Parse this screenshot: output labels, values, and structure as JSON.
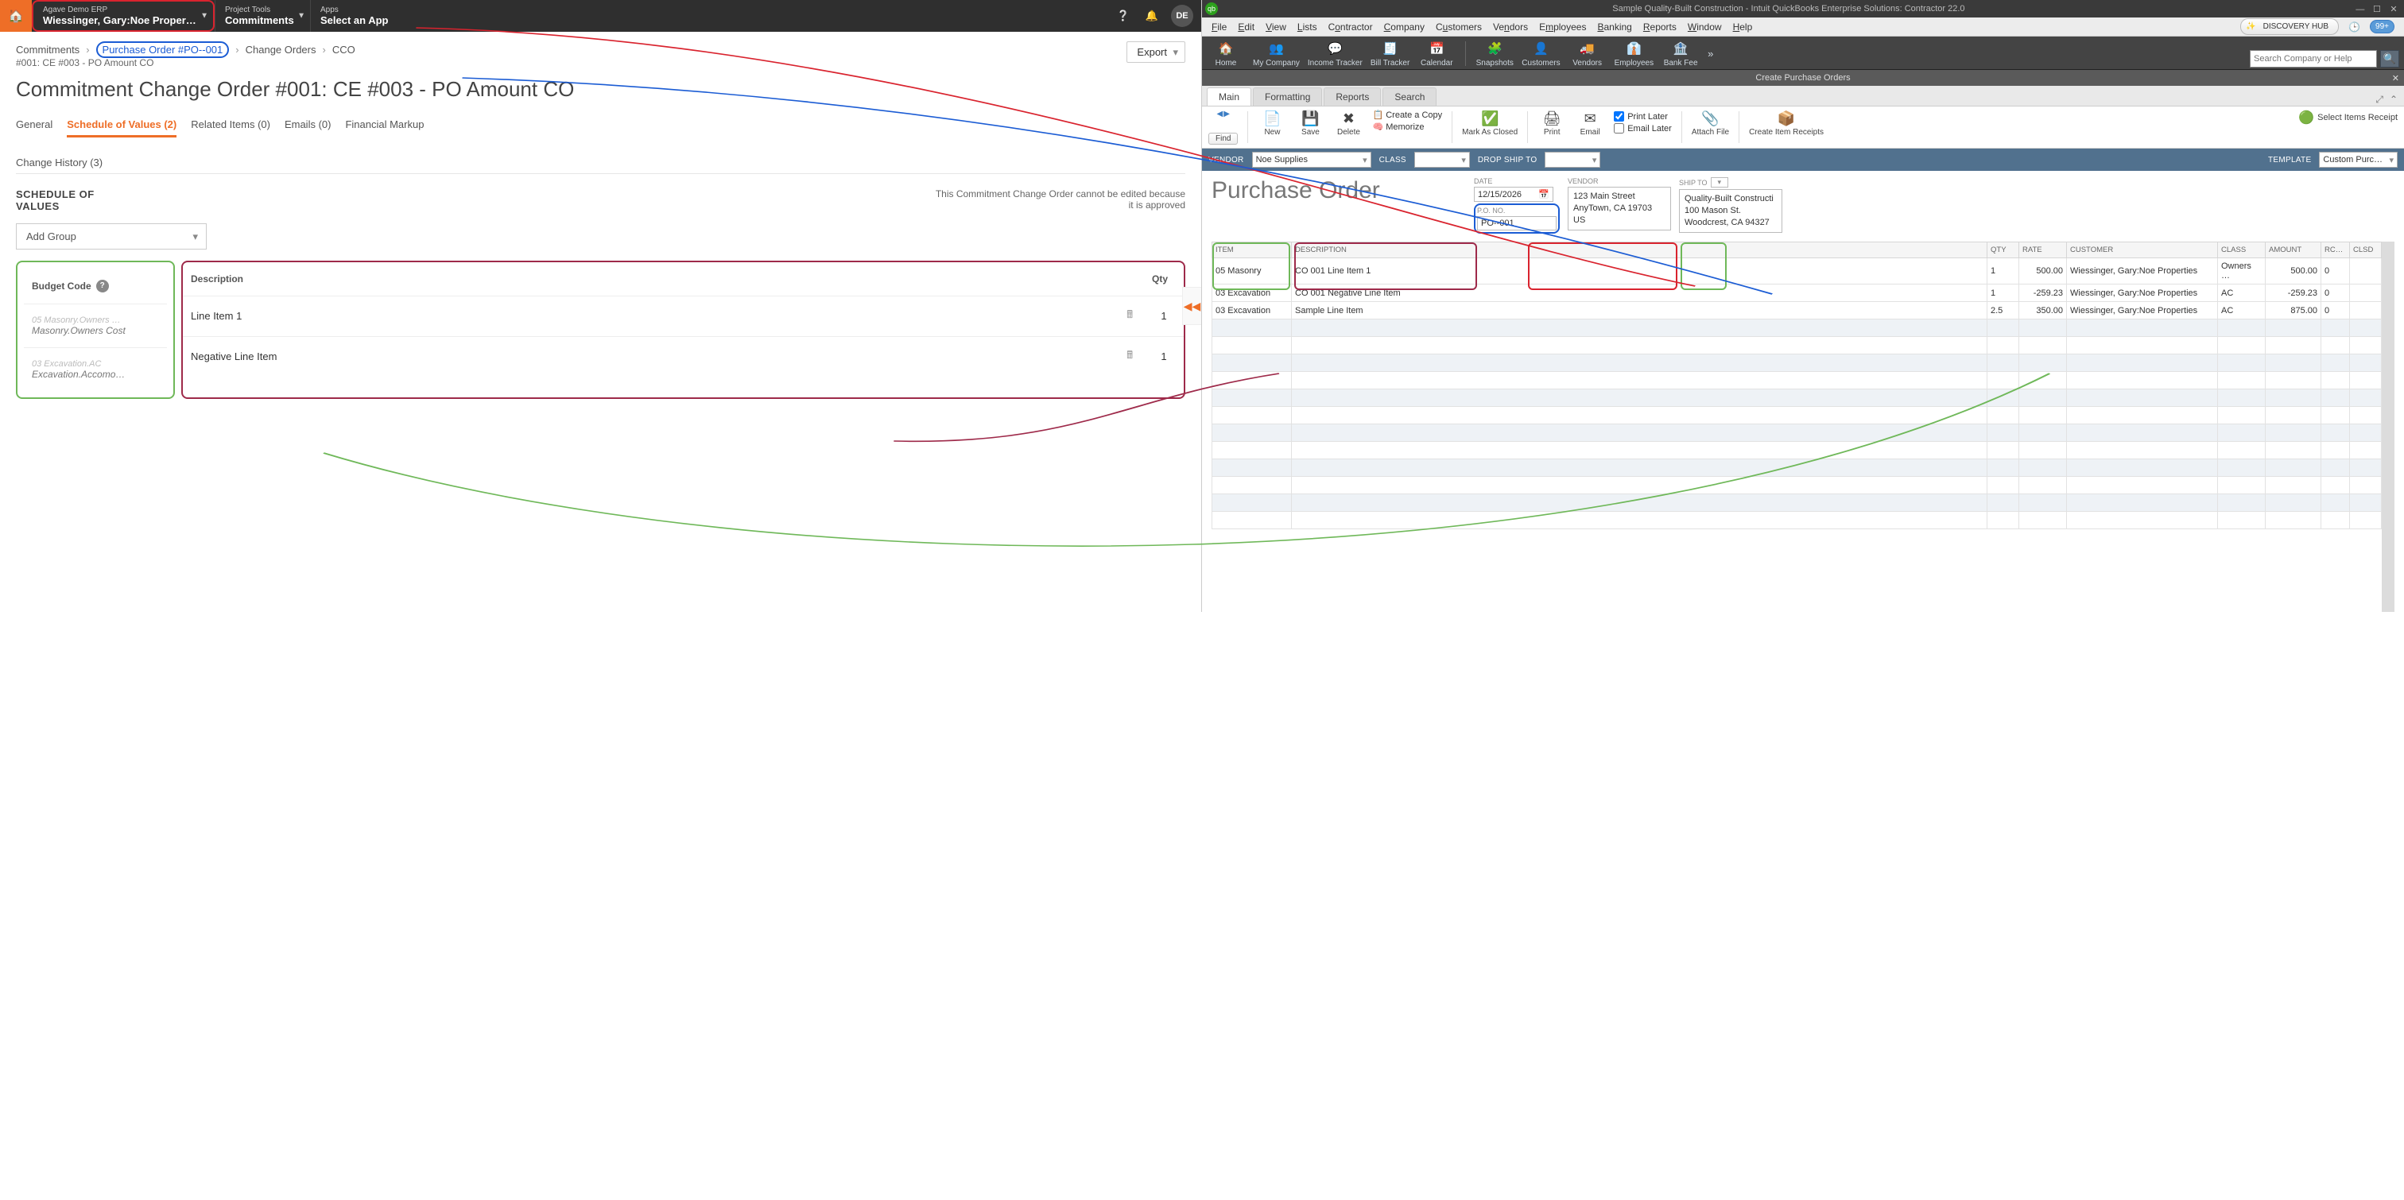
{
  "procore": {
    "erp_label": "Agave Demo ERP",
    "erp_value": "Wiessinger, Gary:Noe Proper…",
    "tools_label": "Project Tools",
    "tools_value": "Commitments",
    "apps_label": "Apps",
    "apps_value": "Select an App",
    "avatar": "DE",
    "breadcrumb": {
      "c1": "Commitments",
      "c2": "Purchase Order #PO--001",
      "c3": "Change Orders",
      "c4": "CCO",
      "sub": "#001: CE #003 - PO Amount CO"
    },
    "export": "Export",
    "page_title": "Commitment Change Order #001: CE #003 - PO Amount CO",
    "tabs": {
      "general": "General",
      "sov": "Schedule of Values (2)",
      "related": "Related Items (0)",
      "emails": "Emails (0)",
      "fin": "Financial Markup",
      "history": "Change History (3)"
    },
    "sov_heading": "SCHEDULE OF VALUES",
    "sov_note": "This Commitment Change Order cannot be edited because it is approved",
    "add_group": "Add Group",
    "cols": {
      "budget": "Budget Code",
      "desc": "Description",
      "qty": "Qty"
    },
    "rows": [
      {
        "code_faint": "05 Masonry.Owners …",
        "code_main": "Masonry.Owners Cost",
        "desc": "Line Item 1",
        "qty": "1"
      },
      {
        "code_faint": "03 Excavation.AC",
        "code_main": "Excavation.Accomo…",
        "desc": "Negative Line Item",
        "qty": "1"
      }
    ]
  },
  "qb": {
    "title": "Sample Quality-Built Construction  -  Intuit QuickBooks Enterprise Solutions: Contractor 22.0",
    "menu": [
      "File",
      "Edit",
      "View",
      "Lists",
      "Contractor",
      "Company",
      "Customers",
      "Vendors",
      "Employees",
      "Banking",
      "Reports",
      "Window",
      "Help"
    ],
    "discovery": "DISCOVERY HUB",
    "badge99": "99+",
    "ribbon": [
      {
        "icon": "🏠",
        "label": "Home"
      },
      {
        "icon": "👥",
        "label": "My Company"
      },
      {
        "icon": "💬",
        "label": "Income Tracker"
      },
      {
        "icon": "🧾",
        "label": "Bill Tracker"
      },
      {
        "icon": "📅",
        "label": "Calendar"
      },
      {
        "icon": "🧩",
        "label": "Snapshots"
      },
      {
        "icon": "👤",
        "label": "Customers"
      },
      {
        "icon": "🚚",
        "label": "Vendors"
      },
      {
        "icon": "👔",
        "label": "Employees"
      },
      {
        "icon": "🏦",
        "label": "Bank Fee"
      }
    ],
    "search_placeholder": "Search Company or Help",
    "doc_title_bar": "Create Purchase Orders",
    "subtabs": {
      "main": "Main",
      "formatting": "Formatting",
      "reports": "Reports",
      "search": "Search"
    },
    "tools": {
      "find": "Find",
      "new": "New",
      "save": "Save",
      "delete": "Delete",
      "create_copy": "Create a Copy",
      "memorize": "Memorize",
      "mark_closed": "Mark As Closed",
      "print": "Print",
      "email": "Email",
      "print_later": "Print Later",
      "email_later": "Email Later",
      "attach": "Attach File",
      "create_ir": "Create Item Receipts",
      "sir": "Select Items Receipt"
    },
    "filter": {
      "vendor_lbl": "Vendor",
      "vendor": "Noe Supplies",
      "class_lbl": "Class",
      "class": "",
      "dropship_lbl": "Drop Ship To",
      "dropship": "",
      "template_lbl": "Template",
      "template": "Custom Purc…"
    },
    "doc": {
      "title": "Purchase Order",
      "date_lbl": "DATE",
      "date": "12/15/2026",
      "pono_lbl": "P.O. NO.",
      "pono": "PO--001",
      "vendor_lbl": "VENDOR",
      "vendor_addr": "123 Main Street\nAnyTown, CA 19703\nUS",
      "shipto_lbl": "SHIP TO",
      "shipto_addr": "Quality-Built Constructi\n100 Mason St.\nWoodcrest, CA 94327"
    },
    "grid": {
      "headers": {
        "item": "ITEM",
        "desc": "DESCRIPTION",
        "qty": "QTY",
        "rate": "RATE",
        "cust": "CUSTOMER",
        "class": "CLASS",
        "amount": "AMOUNT",
        "rc": "RC…",
        "clsd": "CLSD"
      },
      "rows": [
        {
          "item": "05 Masonry",
          "desc": "CO 001 Line Item 1",
          "qty": "1",
          "rate": "500.00",
          "cust": "Wiessinger, Gary:Noe Properties",
          "class": "Owners …",
          "amount": "500.00",
          "rc": "0",
          "clsd": ""
        },
        {
          "item": "03 Excavation",
          "desc": "CO 001 Negative Line Item",
          "qty": "1",
          "rate": "-259.23",
          "cust": "Wiessinger, Gary:Noe Properties",
          "class": "AC",
          "amount": "-259.23",
          "rc": "0",
          "clsd": ""
        },
        {
          "item": "03 Excavation",
          "desc": "Sample Line Item",
          "qty": "2.5",
          "rate": "350.00",
          "cust": "Wiessinger, Gary:Noe Properties",
          "class": "AC",
          "amount": "875.00",
          "rc": "0",
          "clsd": ""
        }
      ]
    }
  }
}
